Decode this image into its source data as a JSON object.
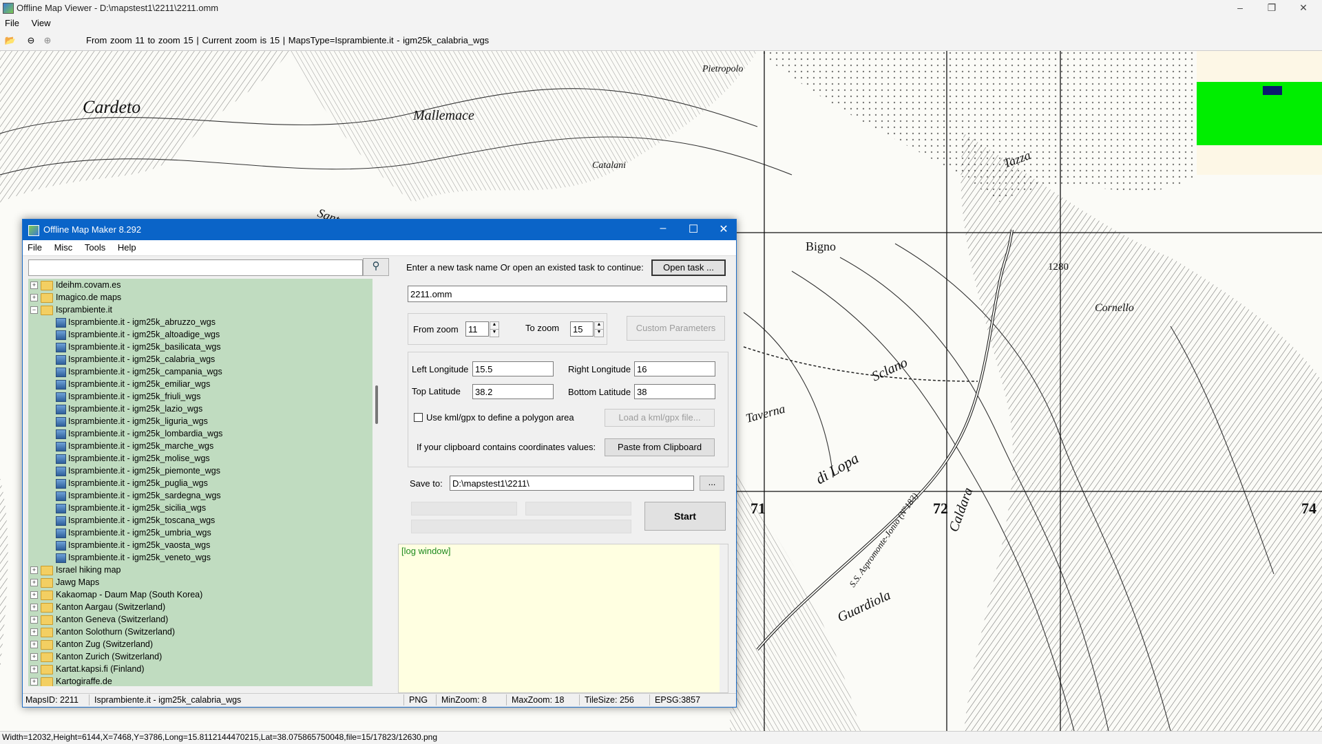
{
  "window": {
    "title": "Offline Map Viewer - D:\\mapstest1\\2211\\2211.omm",
    "controls": [
      "–",
      "❐",
      "✕"
    ]
  },
  "menu": [
    "File",
    "View"
  ],
  "toolbar": {
    "icons": [
      "open-folder-icon",
      "zoom-out-icon",
      "zoom-in-icon"
    ],
    "info": "From zoom 11 to zoom 15   |   Current zoom is 15  |   MapsType=Isprambiente.it - igm25k_calabria_wgs"
  },
  "map": {
    "labels": [
      "Cardeto",
      "Mallemace",
      "Bigno",
      "Sclano",
      "di Lopa",
      "Guardiola",
      "Caldara",
      "Taverna",
      "S.S. Aspromonte-Jonio (N°183)",
      "1280",
      "72",
      "71",
      "74",
      "Tazza",
      "Santa",
      "Catalani",
      "Pietropolo",
      "Cornello"
    ],
    "colors": {
      "legend_bg": "#fdf7e6",
      "legend_green": "#00ee00",
      "legend_navy": "#0a1a6e"
    }
  },
  "statusbar": "Width=12032,Height=6144,X=7468,Y=3786,Long=15.8112144470215,Lat=38.075865750048,file=15/17823/12630.png",
  "dialog": {
    "title": "Offline Map Maker 8.292",
    "controls": [
      "–",
      "☐",
      "✕"
    ],
    "menu": [
      "File",
      "Misc",
      "Tools",
      "Help"
    ],
    "search": {
      "value": "",
      "icon": "search-icon"
    },
    "tree": [
      {
        "label": "Ideihm.covam.es",
        "type": "folder",
        "level": 0,
        "expanded": false
      },
      {
        "label": "Imagico.de maps",
        "type": "folder",
        "level": 0,
        "expanded": false
      },
      {
        "label": "Isprambiente.it",
        "type": "folder",
        "level": 0,
        "expanded": true
      },
      {
        "label": "Isprambiente.it - igm25k_abruzzo_wgs",
        "type": "map",
        "level": 1
      },
      {
        "label": "Isprambiente.it - igm25k_altoadige_wgs",
        "type": "map",
        "level": 1
      },
      {
        "label": "Isprambiente.it - igm25k_basilicata_wgs",
        "type": "map",
        "level": 1
      },
      {
        "label": "Isprambiente.it - igm25k_calabria_wgs",
        "type": "map",
        "level": 1
      },
      {
        "label": "Isprambiente.it - igm25k_campania_wgs",
        "type": "map",
        "level": 1
      },
      {
        "label": "Isprambiente.it - igm25k_emiliar_wgs",
        "type": "map",
        "level": 1
      },
      {
        "label": "Isprambiente.it - igm25k_friuli_wgs",
        "type": "map",
        "level": 1
      },
      {
        "label": "Isprambiente.it - igm25k_lazio_wgs",
        "type": "map",
        "level": 1
      },
      {
        "label": "Isprambiente.it - igm25k_liguria_wgs",
        "type": "map",
        "level": 1
      },
      {
        "label": "Isprambiente.it - igm25k_lombardia_wgs",
        "type": "map",
        "level": 1
      },
      {
        "label": "Isprambiente.it - igm25k_marche_wgs",
        "type": "map",
        "level": 1
      },
      {
        "label": "Isprambiente.it - igm25k_molise_wgs",
        "type": "map",
        "level": 1
      },
      {
        "label": "Isprambiente.it - igm25k_piemonte_wgs",
        "type": "map",
        "level": 1
      },
      {
        "label": "Isprambiente.it - igm25k_puglia_wgs",
        "type": "map",
        "level": 1
      },
      {
        "label": "Isprambiente.it - igm25k_sardegna_wgs",
        "type": "map",
        "level": 1
      },
      {
        "label": "Isprambiente.it - igm25k_sicilia_wgs",
        "type": "map",
        "level": 1
      },
      {
        "label": "Isprambiente.it - igm25k_toscana_wgs",
        "type": "map",
        "level": 1
      },
      {
        "label": "Isprambiente.it - igm25k_umbria_wgs",
        "type": "map",
        "level": 1
      },
      {
        "label": "Isprambiente.it - igm25k_vaosta_wgs",
        "type": "map",
        "level": 1
      },
      {
        "label": "Isprambiente.it - igm25k_veneto_wgs",
        "type": "map",
        "level": 1
      },
      {
        "label": "Israel hiking map",
        "type": "folder",
        "level": 0,
        "expanded": false
      },
      {
        "label": "Jawg Maps",
        "type": "folder",
        "level": 0,
        "expanded": false
      },
      {
        "label": "Kakaomap - Daum Map (South Korea)",
        "type": "folder",
        "level": 0,
        "expanded": false
      },
      {
        "label": "Kanton Aargau (Switzerland)",
        "type": "folder",
        "level": 0,
        "expanded": false
      },
      {
        "label": "Kanton Geneva (Switzerland)",
        "type": "folder",
        "level": 0,
        "expanded": false
      },
      {
        "label": "Kanton Solothurn (Switzerland)",
        "type": "folder",
        "level": 0,
        "expanded": false
      },
      {
        "label": "Kanton Zug (Switzerland)",
        "type": "folder",
        "level": 0,
        "expanded": false
      },
      {
        "label": "Kanton Zurich (Switzerland)",
        "type": "folder",
        "level": 0,
        "expanded": false
      },
      {
        "label": "Kartat.kapsi.fi (Finland)",
        "type": "folder",
        "level": 0,
        "expanded": false
      },
      {
        "label": "Kartogiraffe.de",
        "type": "folder",
        "level": 0,
        "expanded": false
      }
    ],
    "task": {
      "prompt": "Enter a new task name Or open an existed task to continue:",
      "open_button": "Open task ...",
      "name_value": "2211.omm"
    },
    "zoom": {
      "from_label": "From zoom",
      "from_value": "11",
      "to_label": "To zoom",
      "to_value": "15",
      "custom_button": "Custom Parameters"
    },
    "coords": {
      "left_lon_label": "Left Longitude",
      "left_lon": "15.5",
      "right_lon_label": "Right Longitude",
      "right_lon": "16",
      "top_lat_label": "Top Latitude",
      "top_lat": "38.2",
      "bottom_lat_label": "Bottom Latitude",
      "bottom_lat": "38",
      "kml_checkbox": "Use kml/gpx to define a polygon area",
      "kml_checked": false,
      "kml_button": "Load a kml/gpx file...",
      "clipboard_label": "If your clipboard contains coordinates values:",
      "clipboard_button": "Paste from Clipboard"
    },
    "save": {
      "label": "Save to:",
      "value": "D:\\mapstest1\\2211\\",
      "browse": "..."
    },
    "start_button": "Start",
    "log": "[log window]",
    "status": {
      "maps_id": "MapsID: 2211",
      "maps_name": "Isprambiente.it - igm25k_calabria_wgs",
      "format": "PNG",
      "minzoom": "MinZoom: 8",
      "maxzoom": "MaxZoom: 18",
      "tilesize": "TileSize: 256",
      "epsg": "EPSG:3857"
    }
  }
}
